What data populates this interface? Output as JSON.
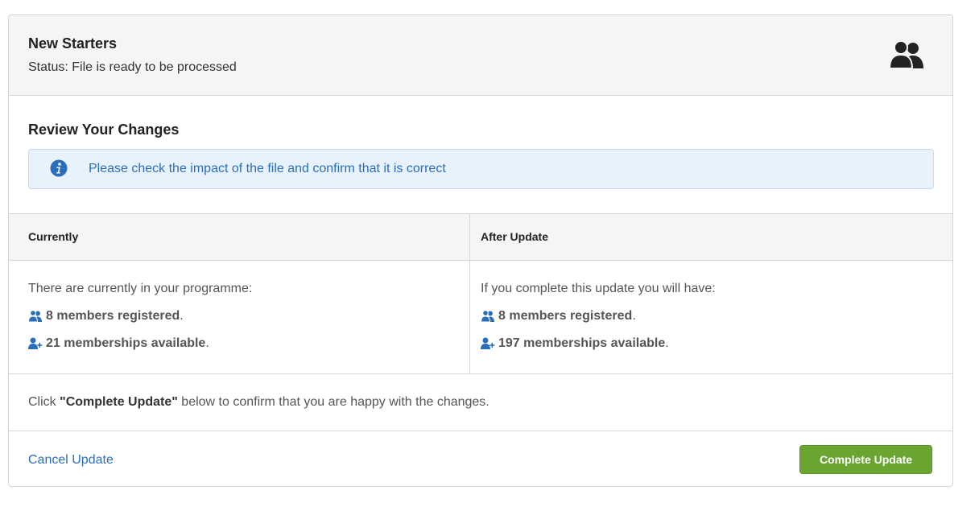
{
  "header": {
    "title": "New Starters",
    "status": "Status: File is ready to be processed",
    "icon": "users-icon"
  },
  "review": {
    "title": "Review Your Changes",
    "alert_icon": "info-icon",
    "alert_text": "Please check the impact of the file and confirm that it is correct"
  },
  "comparison": {
    "currently": {
      "heading": "Currently",
      "intro": "There are currently in your programme:",
      "members_registered": "8 members registered",
      "memberships_available": "21 memberships available"
    },
    "after_update": {
      "heading": "After Update",
      "intro": "If you complete this update you will have:",
      "members_registered": "8 members registered",
      "memberships_available": "197 memberships available"
    },
    "period": "."
  },
  "confirm": {
    "prefix": "Click ",
    "strong": "\"Complete Update\"",
    "suffix": " below to confirm that you are happy with the changes."
  },
  "footer": {
    "cancel_label": "Cancel Update",
    "complete_label": "Complete Update"
  },
  "colors": {
    "accent_blue": "#2a6ebb",
    "success_green": "#6aa531",
    "header_bg": "#f5f5f5",
    "alert_bg": "#e8f2fc"
  }
}
